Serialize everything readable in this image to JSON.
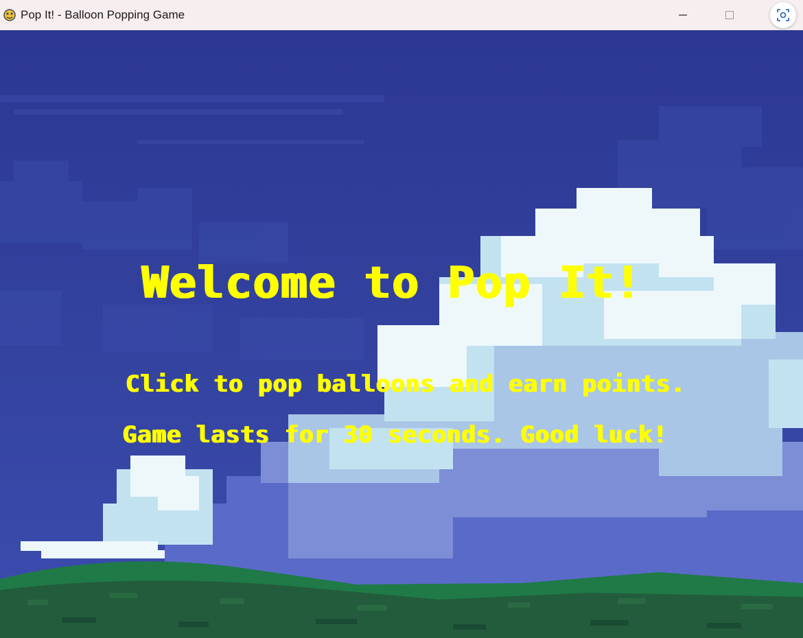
{
  "window": {
    "title": "Pop It! - Balloon Popping Game",
    "app_icon": "pygame-snake-icon",
    "controls": {
      "minimize": "minimize-icon",
      "maximize": "maximize-icon",
      "close": "close-icon"
    }
  },
  "game": {
    "welcome_text": "Welcome to Pop It!",
    "instruction_line1": "Click to pop balloons and earn points.",
    "instruction_line2": "Game lasts for 30 seconds. Good luck!",
    "text_color": "#ffff00",
    "sky_color": "#2d3a8c",
    "cloud_color": "#eef8fb",
    "grass_color": "#235c3c"
  }
}
